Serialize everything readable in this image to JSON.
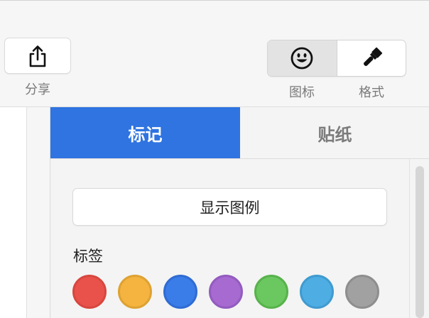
{
  "toolbar": {
    "share_label": "分享",
    "icon_label": "图标",
    "format_label": "格式",
    "icons": {
      "share": "share-icon",
      "smiley": "smiley-icon",
      "paintbrush": "paintbrush-icon"
    }
  },
  "panel": {
    "tabs": [
      {
        "label": "标记",
        "active": true
      },
      {
        "label": "贴纸",
        "active": false
      }
    ],
    "legend_button_label": "显示图例",
    "tags_title": "标签",
    "accent_color": "#2f74e0",
    "tag_colors": [
      {
        "name": "red",
        "fill": "#e8524a",
        "ring": "#d7473f"
      },
      {
        "name": "orange",
        "fill": "#f4b43f",
        "ring": "#dea233"
      },
      {
        "name": "blue",
        "fill": "#3a7ce8",
        "ring": "#2f6cd3"
      },
      {
        "name": "purple",
        "fill": "#a66ad1",
        "ring": "#935bbf"
      },
      {
        "name": "green",
        "fill": "#6bc75f",
        "ring": "#58b24c"
      },
      {
        "name": "light-blue",
        "fill": "#4eaee3",
        "ring": "#3f9bd0"
      },
      {
        "name": "gray",
        "fill": "#a1a1a1",
        "ring": "#8e8e8e"
      }
    ]
  }
}
